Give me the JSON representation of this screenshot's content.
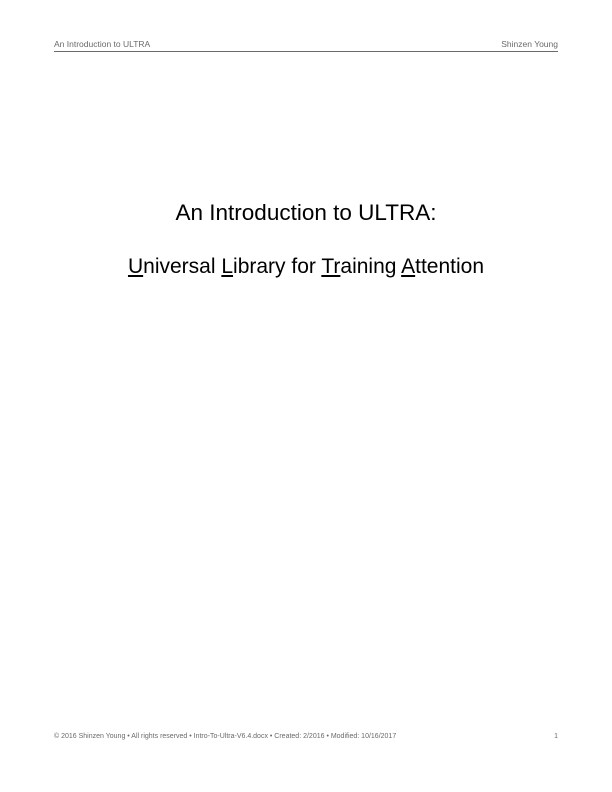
{
  "header": {
    "left": "An Introduction to ULTRA",
    "right": "Shinzen Young"
  },
  "title": {
    "line1": "An Introduction to ULTRA:",
    "line2": {
      "w1_first": "U",
      "w1_rest": "niversal ",
      "w2_first": "L",
      "w2_rest": "ibrary for ",
      "w3_first": "Tr",
      "w3_rest": "aining ",
      "w4_first": "A",
      "w4_rest": "ttention"
    }
  },
  "footer": {
    "left": "© 2016 Shinzen Young • All rights reserved • Intro-To-Ultra-V6.4.docx • Created: 2/2016 • Modified: 10/16/2017",
    "page_number": "1"
  }
}
